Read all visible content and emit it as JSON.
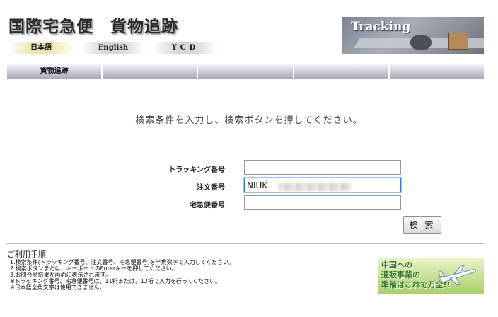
{
  "header": {
    "title": "国際宅急便　貨物追跡",
    "languages": [
      "日本語",
      "English",
      "YCD"
    ],
    "banner_text": "Tracking"
  },
  "nav": {
    "tabs": [
      "貨物追跡",
      "",
      "",
      "",
      ""
    ]
  },
  "form": {
    "instruction": "検索条件を入力し、検索ボタンを押してください。",
    "tracking_label": "トラッキング番号",
    "tracking_value": "",
    "order_label": "注文番号",
    "order_value": "NIUK",
    "takkyubin_label": "宅急便番号",
    "takkyubin_value": "",
    "search_button": "検 索"
  },
  "guide": {
    "title": "ご利用手順",
    "steps": [
      "1.検索条件(トラッキング番号、注文番号、宅急便番号)を半角数字で入力してください。",
      "2.検索ボタンまたは、キーボードのEnterキーを押してください。",
      "3.お問合せ結果が画面に表示されます。",
      "※トラッキング番号、宅急便番号は、11桁または、12桁で入力を行ってください。",
      "※日本語全角文字は使用できません。"
    ]
  },
  "ad": {
    "line1": "中国への",
    "line2": "通販事業の",
    "line3": "準備はこれで万全!!"
  }
}
